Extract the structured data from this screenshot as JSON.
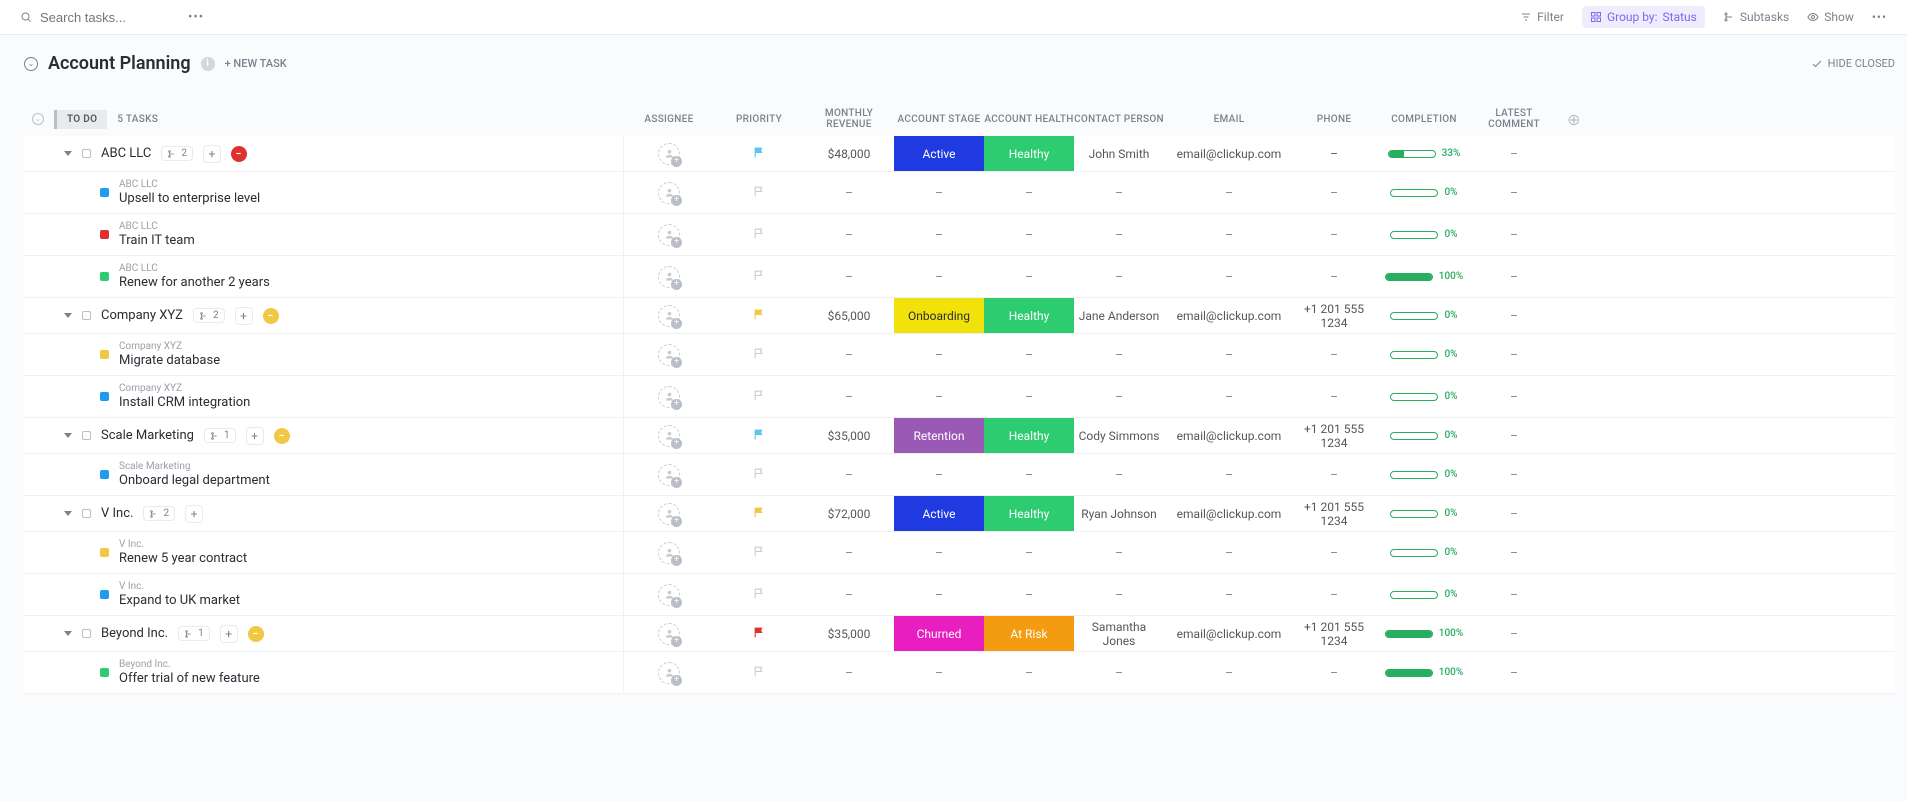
{
  "topbar": {
    "search_placeholder": "Search tasks...",
    "filter": "Filter",
    "group_by_prefix": "Group by:",
    "group_by_value": "Status",
    "subtasks": "Subtasks",
    "show": "Show"
  },
  "header": {
    "title": "Account Planning",
    "new_task": "+ NEW TASK",
    "hide_closed": "HIDE CLOSED"
  },
  "columns": {
    "assignee": "ASSIGNEE",
    "priority": "PRIORITY",
    "monthly_revenue": "MONTHLY REVENUE",
    "account_stage": "ACCOUNT STAGE",
    "account_health": "ACCOUNT HEALTH",
    "contact_person": "CONTACT PERSON",
    "email": "EMAIL",
    "phone": "PHONE",
    "completion": "COMPLETION",
    "latest_comment": "LATEST COMMENT"
  },
  "group": {
    "status": "TO DO",
    "count": "5 TASKS"
  },
  "tasks": [
    {
      "name": "ABC LLC",
      "sq_color": "#b9bec7",
      "sq_outline": true,
      "subtask_count": "2",
      "prio_icon": "minus",
      "prio_bg": "#e03131",
      "flag": "#5bc5f2",
      "revenue": "$48,000",
      "stage": "Active",
      "stage_color": "#1f3ae0",
      "health": "Healthy",
      "health_color": "#2ecc71",
      "contact": "John Smith",
      "email": "email@clickup.com",
      "phone": "–",
      "completion": 33,
      "subtasks": [
        {
          "parent": "ABC LLC",
          "name": "Upsell to enterprise level",
          "sq_color": "#1f9cf0",
          "completion": 0
        },
        {
          "parent": "ABC LLC",
          "name": "Train IT team",
          "sq_color": "#e03131",
          "completion": 0
        },
        {
          "parent": "ABC LLC",
          "name": "Renew for another 2 years",
          "sq_color": "#2ecc71",
          "completion": 100
        }
      ]
    },
    {
      "name": "Company XYZ",
      "sq_color": "#b9bec7",
      "sq_outline": true,
      "subtask_count": "2",
      "prio_icon": "minus",
      "prio_bg": "#f2c744",
      "flag": "#f2c744",
      "revenue": "$65,000",
      "stage": "Onboarding",
      "stage_color": "#f2e20c",
      "stage_text": "#292d34",
      "health": "Healthy",
      "health_color": "#2ecc71",
      "contact": "Jane Anderson",
      "email": "email@clickup.com",
      "phone": "+1 201 555 1234",
      "completion": 0,
      "subtasks": [
        {
          "parent": "Company XYZ",
          "name": "Migrate database",
          "sq_color": "#f2c744",
          "completion": 0
        },
        {
          "parent": "Company XYZ",
          "name": "Install CRM integration",
          "sq_color": "#1f9cf0",
          "completion": 0
        }
      ]
    },
    {
      "name": "Scale Marketing",
      "sq_color": "#b9bec7",
      "sq_outline": true,
      "subtask_count": "1",
      "prio_icon": "minus",
      "prio_bg": "#f2c744",
      "flag": "#5bc5f2",
      "revenue": "$35,000",
      "stage": "Retention",
      "stage_color": "#9b59b6",
      "health": "Healthy",
      "health_color": "#2ecc71",
      "contact": "Cody Simmons",
      "email": "email@clickup.com",
      "phone": "+1 201 555 1234",
      "completion": 0,
      "subtasks": [
        {
          "parent": "Scale Marketing",
          "name": "Onboard legal department",
          "sq_color": "#1f9cf0",
          "completion": 0
        }
      ]
    },
    {
      "name": "V Inc.",
      "sq_color": "#b9bec7",
      "sq_outline": true,
      "subtask_count": "2",
      "prio_icon": null,
      "flag": "#f2c744",
      "revenue": "$72,000",
      "stage": "Active",
      "stage_color": "#1f3ae0",
      "health": "Healthy",
      "health_color": "#2ecc71",
      "contact": "Ryan Johnson",
      "email": "email@clickup.com",
      "phone": "+1 201 555 1234",
      "completion": 0,
      "subtasks": [
        {
          "parent": "V Inc.",
          "name": "Renew 5 year contract",
          "sq_color": "#f2c744",
          "completion": 0
        },
        {
          "parent": "V Inc.",
          "name": "Expand to UK market",
          "sq_color": "#1f9cf0",
          "completion": 0
        }
      ]
    },
    {
      "name": "Beyond Inc.",
      "sq_color": "#b9bec7",
      "sq_outline": true,
      "subtask_count": "1",
      "prio_icon": "minus",
      "prio_bg": "#f2c744",
      "flag": "#e03131",
      "revenue": "$35,000",
      "stage": "Churned",
      "stage_color": "#e91ec0",
      "health": "At Risk",
      "health_color": "#f39c12",
      "contact": "Samantha Jones",
      "email": "email@clickup.com",
      "phone": "+1 201 555 1234",
      "completion": 100,
      "subtasks": [
        {
          "parent": "Beyond Inc.",
          "name": "Offer trial of new feature",
          "sq_color": "#2ecc71",
          "completion": 100
        }
      ]
    }
  ]
}
